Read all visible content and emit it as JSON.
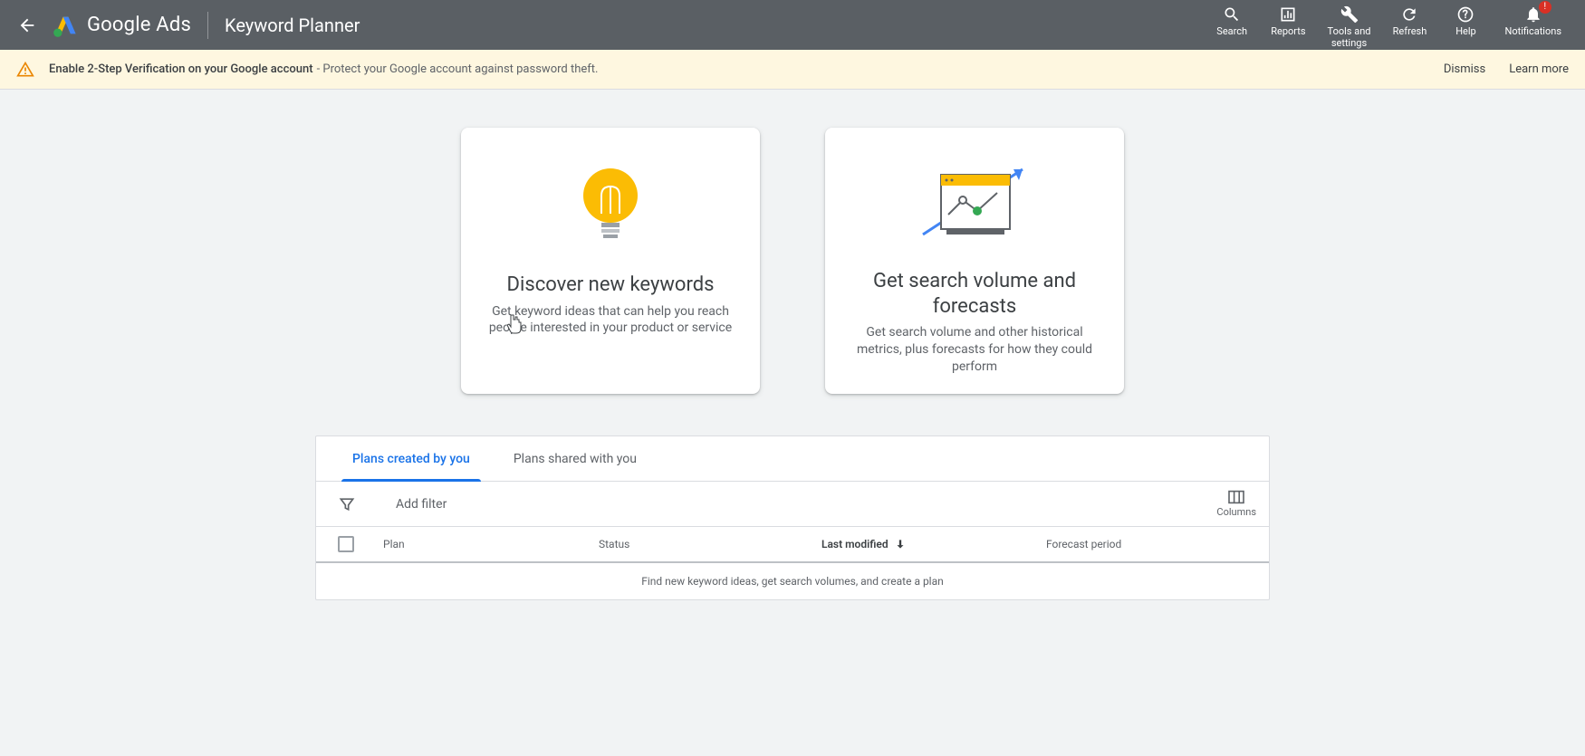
{
  "header": {
    "product_name": "Google Ads",
    "tool_title": "Keyword Planner",
    "actions": {
      "search": "Search",
      "reports": "Reports",
      "tools": "Tools and\nsettings",
      "refresh": "Refresh",
      "help": "Help",
      "notifications": "Notifications",
      "notif_badge": "!"
    }
  },
  "banner": {
    "bold": "Enable 2-Step Verification on your Google account",
    "sep": " - ",
    "rest": "Protect your Google account against password theft.",
    "dismiss": "Dismiss",
    "learn_more": "Learn more"
  },
  "cards": {
    "discover": {
      "title": "Discover new keywords",
      "desc": "Get keyword ideas that can help you reach people interested in your product or service"
    },
    "forecast": {
      "title": "Get search volume and forecasts",
      "desc": "Get search volume and other historical metrics, plus forecasts for how they could perform"
    }
  },
  "tabs": {
    "mine": "Plans created by you",
    "shared": "Plans shared with you"
  },
  "filter": {
    "add_filter": "Add filter",
    "columns": "Columns"
  },
  "table": {
    "headers": {
      "plan": "Plan",
      "status": "Status",
      "modified": "Last modified",
      "forecast": "Forecast period"
    },
    "empty_message": "Find new keyword ideas, get search volumes, and create a plan"
  }
}
